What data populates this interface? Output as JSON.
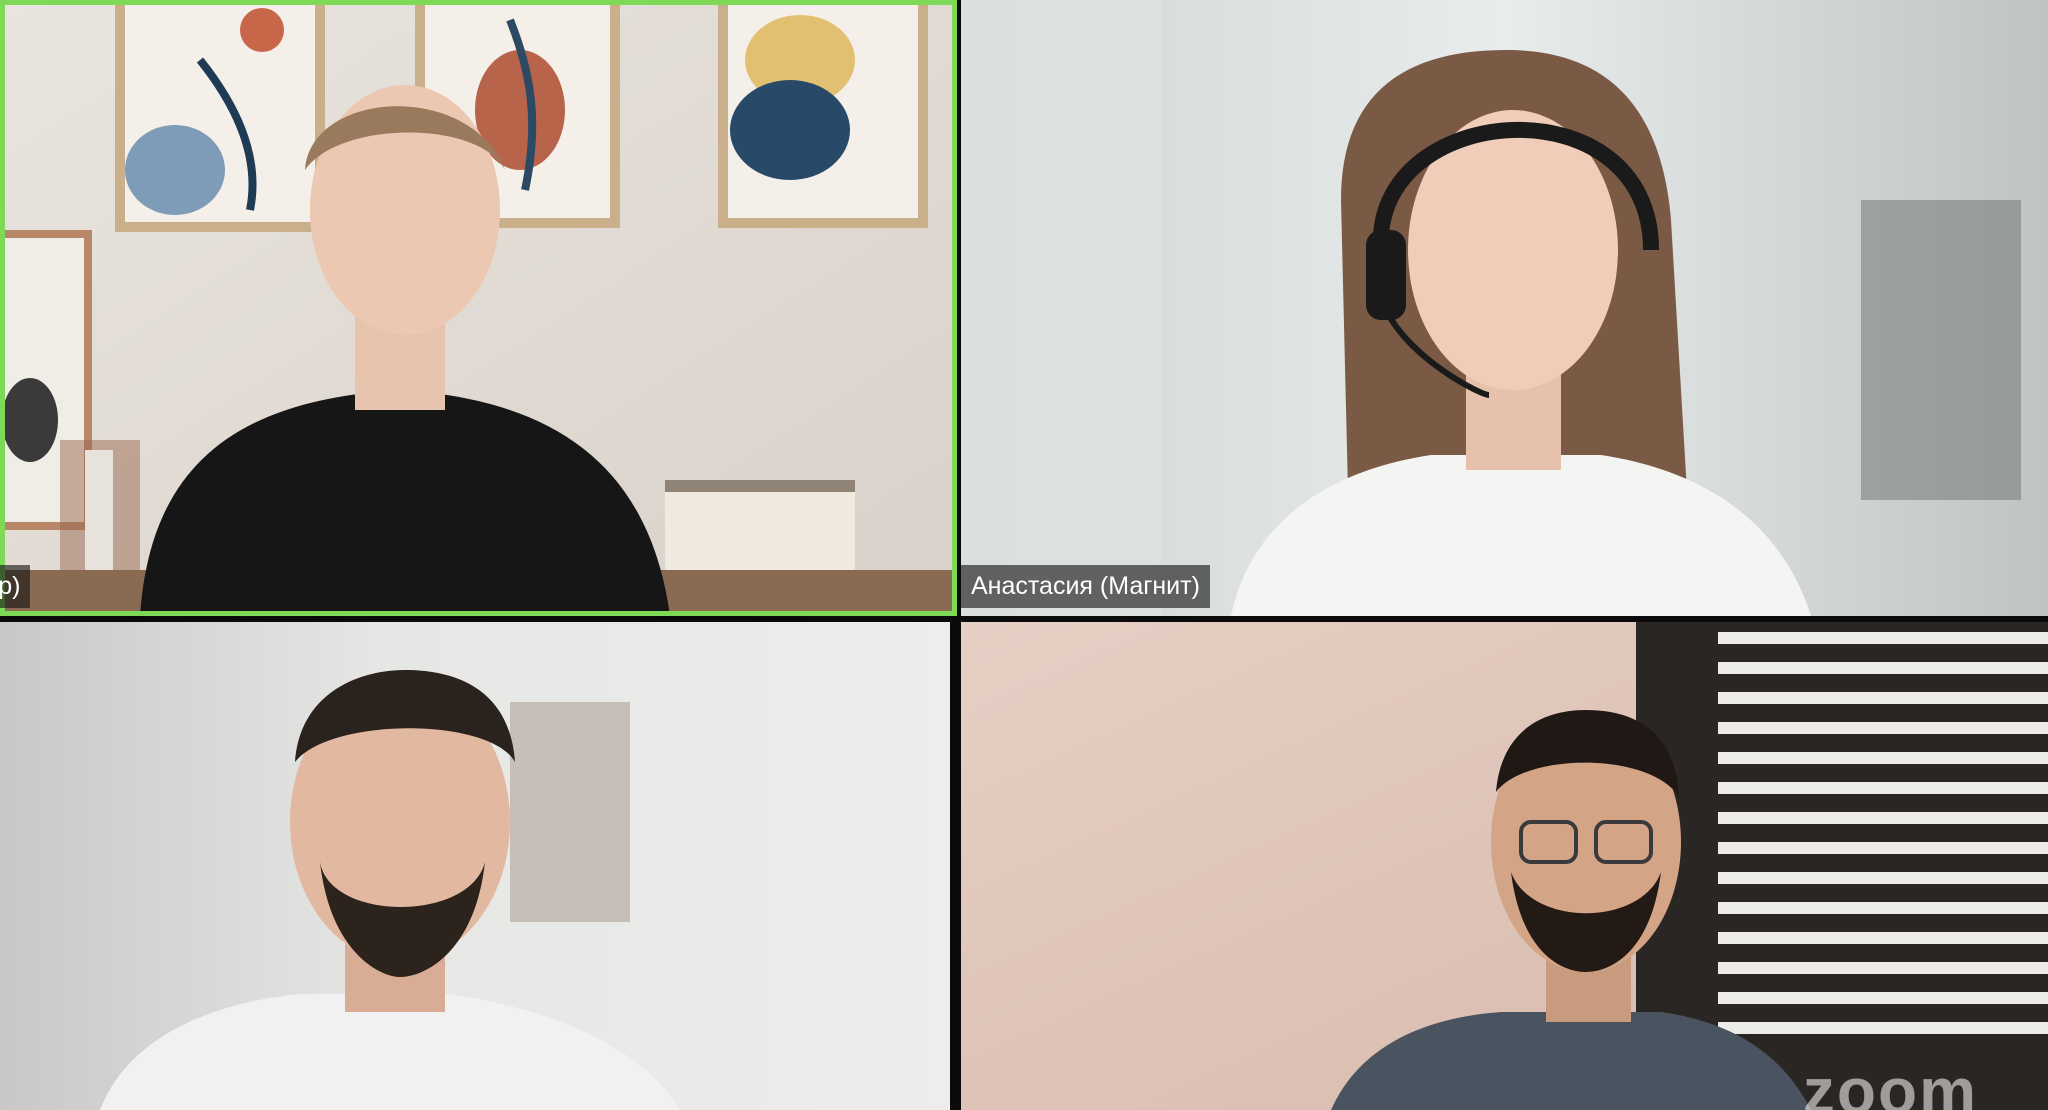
{
  "meeting": {
    "layout": "gallery-2x2",
    "active_speaker_color": "#7ed957"
  },
  "participants": [
    {
      "name": "абр)",
      "active_speaker": true
    },
    {
      "name": "Анастасия (Магнит)",
      "active_speaker": false
    },
    {
      "name": "",
      "active_speaker": false
    },
    {
      "name": "",
      "active_speaker": false
    }
  ],
  "branding": {
    "watermark": "zoom"
  }
}
